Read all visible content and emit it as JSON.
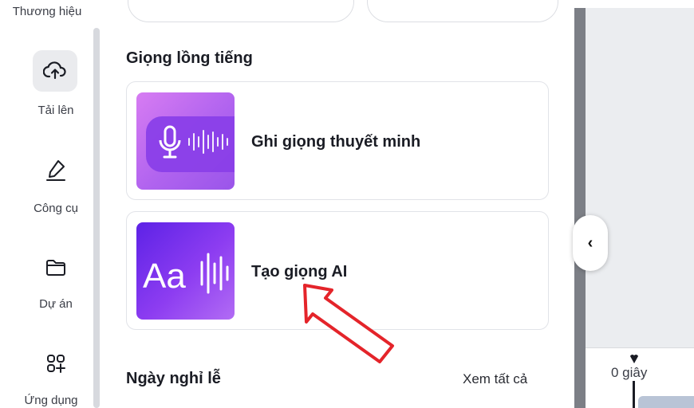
{
  "rail": {
    "partial_top_label": "Thương hiệu",
    "items": [
      {
        "label": "Tải lên",
        "icon": "cloud-upload-icon"
      },
      {
        "label": "Công cụ",
        "icon": "pen-tool-icon"
      },
      {
        "label": "Dự án",
        "icon": "folder-icon"
      },
      {
        "label": "Ứng dụng",
        "icon": "apps-grid-icon"
      }
    ]
  },
  "panel": {
    "voiceover_title": "Giọng lồng tiếng",
    "cards": [
      {
        "label": "Ghi giọng thuyết minh",
        "thumb": "microphone-waveform"
      },
      {
        "label": "Tạo giọng AI",
        "thumb": "aa-waveform"
      }
    ],
    "holidays_title": "Ngày nghỉ lễ",
    "see_all": "Xem tất cả"
  },
  "collapse_icon": "‹",
  "timeline": {
    "time_label": "0 giây"
  },
  "colors": {
    "annotation_arrow": "#e4242a",
    "thumb_mic_bg": "#b76cf0",
    "thumb_ai_bg": "#7a2ff0"
  }
}
